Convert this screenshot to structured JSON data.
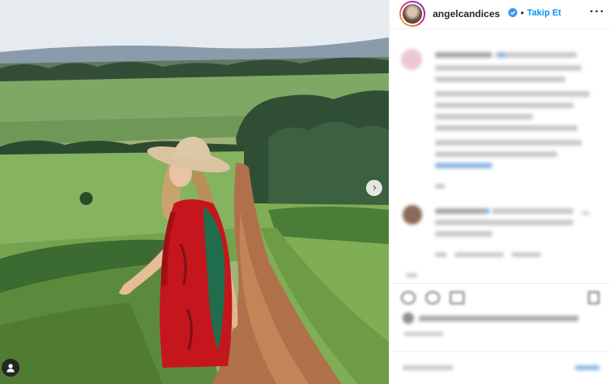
{
  "post": {
    "username": "angelcandices",
    "separator": "•",
    "follow_label": "Takip Et",
    "more_label": "···",
    "next_label": "›"
  },
  "icons": {
    "verified": "verified-badge-icon",
    "more": "more-options-icon",
    "next": "chevron-right-icon",
    "tag": "user-tag-icon"
  },
  "colors": {
    "accent": "#0095f6",
    "dress": "#c5161d",
    "hat": "#d9c3a0"
  }
}
